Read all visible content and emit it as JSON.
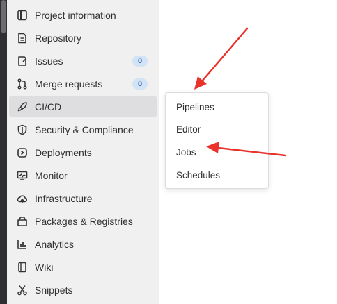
{
  "sidebar": {
    "items": [
      {
        "label": "Project information",
        "icon": "project-icon"
      },
      {
        "label": "Repository",
        "icon": "document-icon"
      },
      {
        "label": "Issues",
        "icon": "issues-icon",
        "badge": "0"
      },
      {
        "label": "Merge requests",
        "icon": "merge-request-icon",
        "badge": "0"
      },
      {
        "label": "CI/CD",
        "icon": "rocket-icon",
        "active": true
      },
      {
        "label": "Security & Compliance",
        "icon": "shield-icon"
      },
      {
        "label": "Deployments",
        "icon": "deployments-icon"
      },
      {
        "label": "Monitor",
        "icon": "monitor-icon"
      },
      {
        "label": "Infrastructure",
        "icon": "cloud-icon"
      },
      {
        "label": "Packages & Registries",
        "icon": "package-icon"
      },
      {
        "label": "Analytics",
        "icon": "chart-icon"
      },
      {
        "label": "Wiki",
        "icon": "book-icon"
      },
      {
        "label": "Snippets",
        "icon": "scissors-icon"
      }
    ]
  },
  "cicd_flyout": {
    "items": [
      "Pipelines",
      "Editor",
      "Jobs",
      "Schedules"
    ]
  },
  "colors": {
    "sidebar_bg": "#f0f0f0",
    "active_bg": "#dedee0",
    "badge_bg": "#d2e3f6",
    "badge_text": "#1f5aa8",
    "annotation_arrow": "#e8322a"
  }
}
